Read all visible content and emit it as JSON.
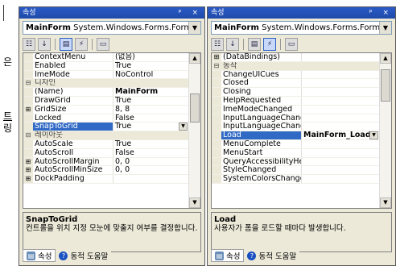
{
  "background": {
    "fragments": [
      "은",
      "트",
      "링"
    ]
  },
  "left_panel": {
    "title": "속성",
    "title_controls": "ᵖ ×",
    "object_combo": {
      "name": "MainForm",
      "type": "System.Windows.Forms.Form"
    },
    "rows": [
      {
        "kind": "prop",
        "name": "ContextMenu",
        "value": "(없음)"
      },
      {
        "kind": "prop",
        "name": "Enabled",
        "value": "True"
      },
      {
        "kind": "prop",
        "name": "ImeMode",
        "value": "NoControl"
      },
      {
        "kind": "cat",
        "name": "디자인",
        "gutter": "⊟"
      },
      {
        "kind": "prop",
        "name": "(Name)",
        "value": "MainForm",
        "bold": true
      },
      {
        "kind": "prop",
        "name": "DrawGrid",
        "value": "True"
      },
      {
        "kind": "prop",
        "name": "GridSize",
        "value": "8, 8",
        "gutter": "⊞"
      },
      {
        "kind": "prop",
        "name": "Locked",
        "value": "False"
      },
      {
        "kind": "prop",
        "name": "SnapToGrid",
        "value": "True",
        "selected": true,
        "dropdown": true
      },
      {
        "kind": "cat",
        "name": "레이아웃",
        "gutter": "⊟"
      },
      {
        "kind": "prop",
        "name": "AutoScale",
        "value": "True"
      },
      {
        "kind": "prop",
        "name": "AutoScroll",
        "value": "False"
      },
      {
        "kind": "prop",
        "name": "AutoScrollMargin",
        "value": "0, 0",
        "gutter": "⊞"
      },
      {
        "kind": "prop",
        "name": "AutoScrollMinSize",
        "value": "0, 0",
        "gutter": "⊞"
      },
      {
        "kind": "prop",
        "name": "DockPadding",
        "value": "",
        "gutter": "⊞"
      }
    ],
    "description": {
      "title": "SnapToGrid",
      "text": "컨트롤을 위치 지정 모눈에 맞출지 여부를 결정합니다."
    },
    "tabs": {
      "properties": "속성",
      "dynamic_help": "동적 도움말"
    }
  },
  "right_panel": {
    "title": "속성",
    "title_controls": "ᵖ ×",
    "object_combo": {
      "name": "MainForm",
      "type": "System.Windows.Forms.Form"
    },
    "rows": [
      {
        "kind": "prop",
        "name": "(DataBindings)",
        "value": "",
        "gutter": "⊞"
      },
      {
        "kind": "cat",
        "name": "동작",
        "gutter": "⊟"
      },
      {
        "kind": "prop",
        "name": "ChangeUICues",
        "value": ""
      },
      {
        "kind": "prop",
        "name": "Closed",
        "value": ""
      },
      {
        "kind": "prop",
        "name": "Closing",
        "value": ""
      },
      {
        "kind": "prop",
        "name": "HelpRequested",
        "value": ""
      },
      {
        "kind": "prop",
        "name": "ImeModeChanged",
        "value": ""
      },
      {
        "kind": "prop",
        "name": "InputLanguageChang",
        "value": ""
      },
      {
        "kind": "prop",
        "name": "InputLanguageChang",
        "value": ""
      },
      {
        "kind": "prop",
        "name": "Load",
        "value": "MainForm_Load",
        "selected": true,
        "bold": true,
        "dropdown": true
      },
      {
        "kind": "prop",
        "name": "MenuComplete",
        "value": ""
      },
      {
        "kind": "prop",
        "name": "MenuStart",
        "value": ""
      },
      {
        "kind": "prop",
        "name": "QueryAccessibilityHe",
        "value": ""
      },
      {
        "kind": "prop",
        "name": "StyleChanged",
        "value": ""
      },
      {
        "kind": "prop",
        "name": "SystemColorsChanged",
        "value": ""
      }
    ],
    "description": {
      "title": "Load",
      "text": "사용자가 폼을 로드할 때마다 발생합니다."
    },
    "tabs": {
      "properties": "속성",
      "dynamic_help": "동적 도움말"
    }
  }
}
